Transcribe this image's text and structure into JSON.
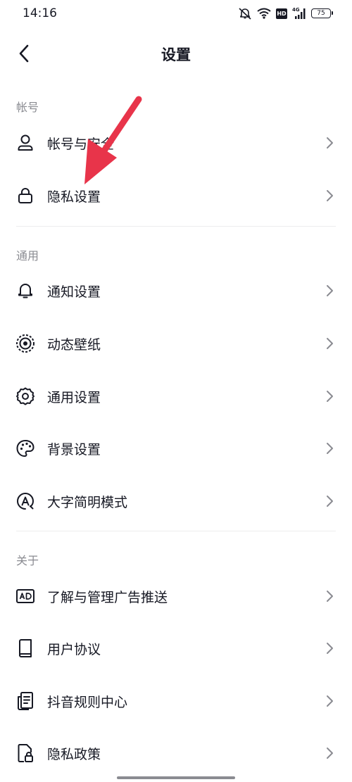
{
  "status": {
    "time": "14:16",
    "battery": "75",
    "hd": "HD",
    "network": "4G"
  },
  "header": {
    "title": "设置"
  },
  "sections": [
    {
      "title": "帐号",
      "items": [
        {
          "label": "帐号与安全",
          "icon": "person-icon"
        },
        {
          "label": "隐私设置",
          "icon": "lock-icon"
        }
      ]
    },
    {
      "title": "通用",
      "items": [
        {
          "label": "通知设置",
          "icon": "bell-icon"
        },
        {
          "label": "动态壁纸",
          "icon": "live-wallpaper-icon"
        },
        {
          "label": "通用设置",
          "icon": "gear-icon"
        },
        {
          "label": "背景设置",
          "icon": "palette-icon"
        },
        {
          "label": "大字简明模式",
          "icon": "large-font-icon"
        }
      ]
    },
    {
      "title": "关于",
      "items": [
        {
          "label": "了解与管理广告推送",
          "icon": "ad-icon"
        },
        {
          "label": "用户协议",
          "icon": "book-icon"
        },
        {
          "label": "抖音规则中心",
          "icon": "rules-document-icon"
        },
        {
          "label": "隐私政策",
          "icon": "privacy-policy-icon"
        }
      ]
    }
  ],
  "colors": {
    "annotation_arrow": "#e8344a",
    "text": "#161823",
    "muted": "#8a8b91"
  }
}
